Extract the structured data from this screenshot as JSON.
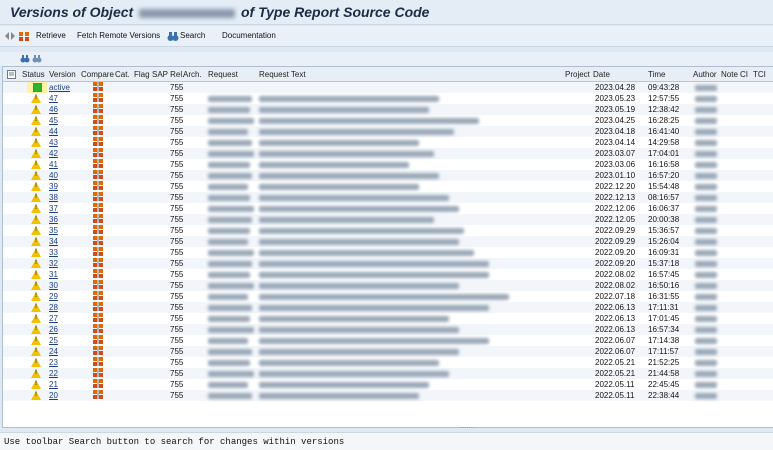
{
  "title": {
    "prefix": "Versions of Object",
    "suffix": "of Type Report Source Code"
  },
  "toolbar": {
    "retrieve": "Retrieve",
    "fetch_remote": "Fetch Remote Versions",
    "search": "Search",
    "documentation": "Documentation"
  },
  "columns": {
    "status": "Status",
    "version": "Version",
    "compare": "Compare",
    "cat": "Cat.",
    "flag": "Flag",
    "sap_rel": "SAP Rel.",
    "arch": "Arch.",
    "request": "Request",
    "request_text": "Request Text",
    "project": "Project",
    "date": "Date",
    "time": "Time",
    "author": "Author",
    "note": "Note",
    "ci": "CI",
    "tci": "TCI"
  },
  "rows": [
    {
      "version": "active",
      "sap_rel": "755",
      "date": "2023.04.28",
      "time": "09:43:28",
      "status": "active"
    },
    {
      "version": "47",
      "sap_rel": "755",
      "date": "2023.05.23",
      "time": "12:57:55",
      "status": "warn"
    },
    {
      "version": "46",
      "sap_rel": "755",
      "date": "2023.05.19",
      "time": "12:38:42",
      "status": "warn"
    },
    {
      "version": "45",
      "sap_rel": "755",
      "date": "2023.04.25",
      "time": "16:28:25",
      "status": "warn"
    },
    {
      "version": "44",
      "sap_rel": "755",
      "date": "2023.04.18",
      "time": "16:41:40",
      "status": "warn"
    },
    {
      "version": "43",
      "sap_rel": "755",
      "date": "2023.04.14",
      "time": "14:29:58",
      "status": "warn"
    },
    {
      "version": "42",
      "sap_rel": "755",
      "date": "2023.03.07",
      "time": "17:04:01",
      "status": "warn"
    },
    {
      "version": "41",
      "sap_rel": "755",
      "date": "2023.03.06",
      "time": "16:16:58",
      "status": "warn"
    },
    {
      "version": "40",
      "sap_rel": "755",
      "date": "2023.01.10",
      "time": "16:57:20",
      "status": "warn"
    },
    {
      "version": "39",
      "sap_rel": "755",
      "date": "2022.12.20",
      "time": "15:54:48",
      "status": "warn"
    },
    {
      "version": "38",
      "sap_rel": "755",
      "date": "2022.12.13",
      "time": "08:16:57",
      "status": "warn"
    },
    {
      "version": "37",
      "sap_rel": "755",
      "date": "2022.12.06",
      "time": "16:06:37",
      "status": "warn"
    },
    {
      "version": "36",
      "sap_rel": "755",
      "date": "2022.12.05",
      "time": "20:00:38",
      "status": "warn"
    },
    {
      "version": "35",
      "sap_rel": "755",
      "date": "2022.09.29",
      "time": "15:36:57",
      "status": "warn"
    },
    {
      "version": "34",
      "sap_rel": "755",
      "date": "2022.09.29",
      "time": "15:26:04",
      "status": "warn"
    },
    {
      "version": "33",
      "sap_rel": "755",
      "date": "2022.09.20",
      "time": "16:09:31",
      "status": "warn"
    },
    {
      "version": "32",
      "sap_rel": "755",
      "date": "2022.09.20",
      "time": "15:37:18",
      "status": "warn"
    },
    {
      "version": "31",
      "sap_rel": "755",
      "date": "2022.08.02",
      "time": "16:57:45",
      "status": "warn"
    },
    {
      "version": "30",
      "sap_rel": "755",
      "date": "2022.08.02",
      "time": "16:50:16",
      "status": "warn"
    },
    {
      "version": "29",
      "sap_rel": "755",
      "date": "2022.07.18",
      "time": "16:31:55",
      "status": "warn"
    },
    {
      "version": "28",
      "sap_rel": "755",
      "date": "2022.06.13",
      "time": "17:11:31",
      "status": "warn"
    },
    {
      "version": "27",
      "sap_rel": "755",
      "date": "2022.06.13",
      "time": "17:01:45",
      "status": "warn"
    },
    {
      "version": "26",
      "sap_rel": "755",
      "date": "2022.06.13",
      "time": "16:57:34",
      "status": "warn"
    },
    {
      "version": "25",
      "sap_rel": "755",
      "date": "2022.06.07",
      "time": "17:14:38",
      "status": "warn"
    },
    {
      "version": "24",
      "sap_rel": "755",
      "date": "2022.06.07",
      "time": "17:11:57",
      "status": "warn"
    },
    {
      "version": "23",
      "sap_rel": "755",
      "date": "2022.05.21",
      "time": "21:52:25",
      "status": "warn"
    },
    {
      "version": "22",
      "sap_rel": "755",
      "date": "2022.05.21",
      "time": "21:44:58",
      "status": "warn"
    },
    {
      "version": "21",
      "sap_rel": "755",
      "date": "2022.05.11",
      "time": "22:45:45",
      "status": "warn"
    },
    {
      "version": "20",
      "sap_rel": "755",
      "date": "2022.05.11",
      "time": "22:38:44",
      "status": "warn"
    }
  ],
  "status_message": "Use toolbar Search button to search for changes within versions",
  "colors": {
    "accent": "#1d3d8a",
    "warning": "#f2c200",
    "active": "#2bb52b"
  },
  "icons": [
    "compare-icon",
    "search-binoculars-icon",
    "retrieve-icon",
    "layout-icon",
    "select-all-icon"
  ]
}
